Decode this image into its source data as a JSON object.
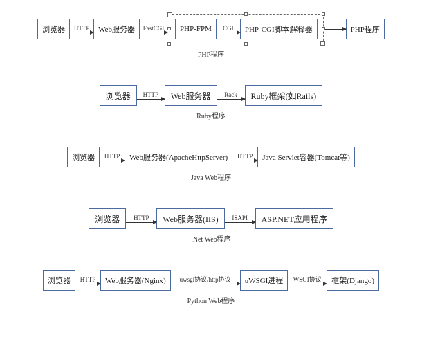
{
  "rows": [
    {
      "caption": "PHP程序",
      "nodes": [
        "浏览器",
        "Web服务器",
        "PHP-FPM",
        "PHP-CGI脚本解释器",
        "PHP程序"
      ],
      "arrows": [
        "HTTP",
        "FastCGI",
        "CGI",
        ""
      ],
      "dashed_group": {
        "start_node_index": 2,
        "end_node_index": 3
      }
    },
    {
      "caption": "Ruby程序",
      "nodes": [
        "浏览器",
        "Web服务器",
        "Ruby框架(如Rails)"
      ],
      "arrows": [
        "HTTP",
        "Rack"
      ]
    },
    {
      "caption": "Java Web程序",
      "nodes": [
        "浏览器",
        "Web服务器(ApacheHttpServer)",
        "Java Servlet容器(Tomcat等)"
      ],
      "arrows": [
        "HTTP",
        "HTTP"
      ]
    },
    {
      "caption": ".Net Web程序",
      "nodes": [
        "浏览器",
        "Web服务器(IIS)",
        "ASP.NET应用程序"
      ],
      "arrows": [
        "HTTP",
        "ISAPI"
      ]
    },
    {
      "caption": "Python Web程序",
      "nodes": [
        "浏览器",
        "Web服务器(Nginx)",
        "uWSGI进程",
        "框架(Django)"
      ],
      "arrows": [
        "HTTP",
        "uwsgi协议/http协议",
        "WSGI协议"
      ]
    }
  ]
}
